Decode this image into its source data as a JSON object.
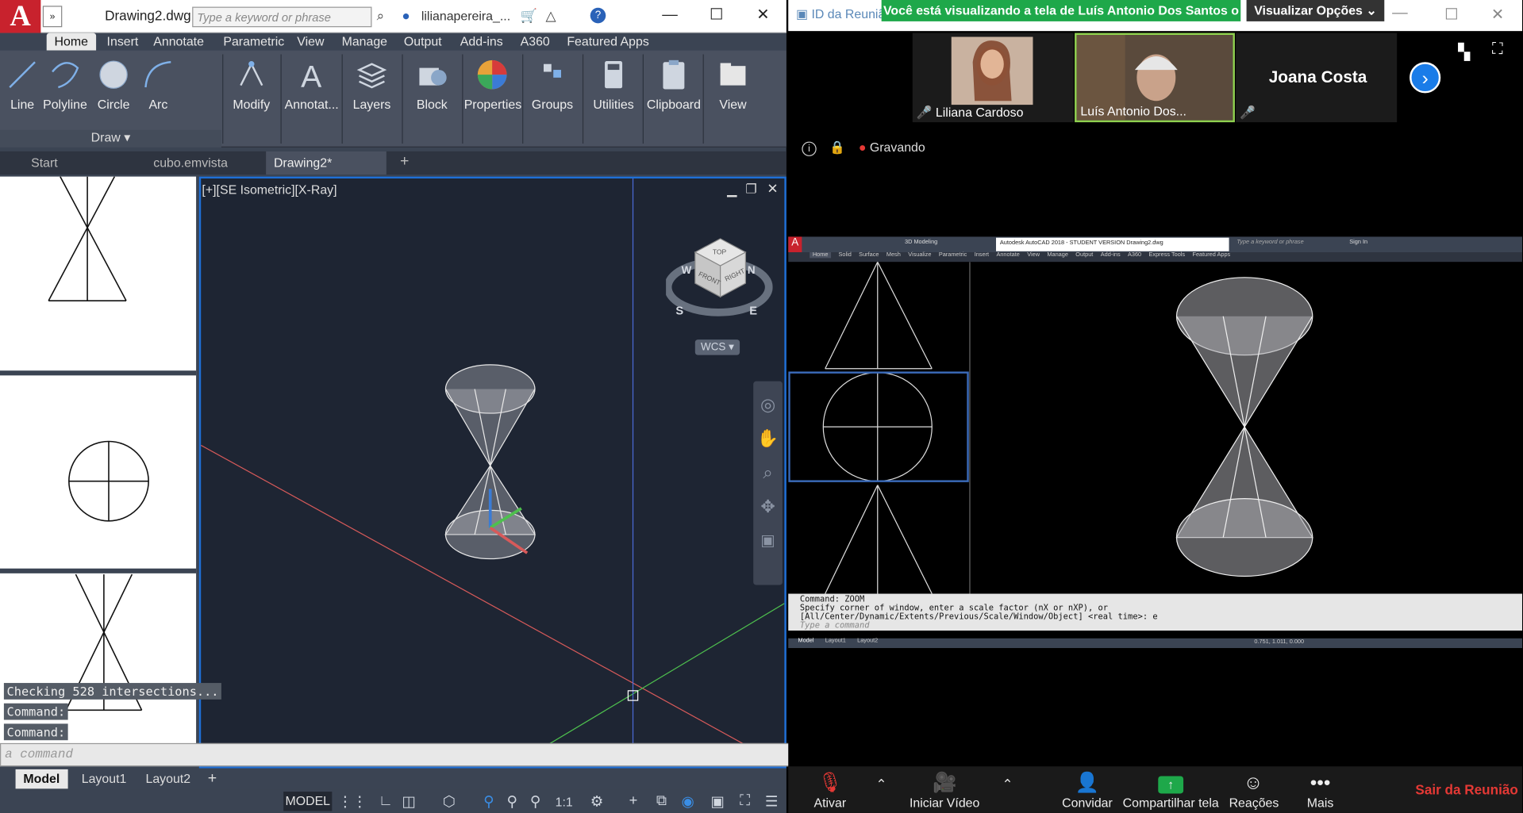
{
  "acad": {
    "title": "Drawing2.dwg",
    "search_placeholder": "Type a keyword or phrase",
    "user": "lilianapereira_...",
    "ribbon_tabs": [
      "Home",
      "Insert",
      "Annotate",
      "Parametric",
      "View",
      "Manage",
      "Output",
      "Add-ins",
      "A360",
      "Featured Apps"
    ],
    "draw_tools": [
      "Line",
      "Polyline",
      "Circle",
      "Arc"
    ],
    "draw_panel": "Draw",
    "panels": [
      "Modify",
      "Annotat...",
      "Layers",
      "Block",
      "Properties",
      "Groups",
      "Utilities",
      "Clipboard",
      "View"
    ],
    "file_tabs": [
      "Start",
      "cubo.emvista",
      "Drawing2*"
    ],
    "viewport_label": "[+][SE Isometric][X-Ray]",
    "viewcube_faces": {
      "top": "TOP",
      "front": "FRONT",
      "right": "RIGHT",
      "compass_s": "S",
      "compass_e": "E",
      "compass_w": "W",
      "compass_n": "N"
    },
    "wcs": "WCS",
    "command_history": [
      "Checking 528 intersections...",
      "Command:",
      "Command:"
    ],
    "command_placeholder": "a command",
    "layout_tabs": [
      "Model",
      "Layout1",
      "Layout2"
    ],
    "status_model": "MODEL",
    "scale": "1:1",
    "colors": {
      "accent": "#1e6fd6",
      "background": "#1e2533",
      "logo": "#c8222d"
    }
  },
  "zoom": {
    "title": "ID da Reuniã",
    "banner": "Você está visualizando a tela de Luís Antonio Dos Santos o",
    "options": "Visualizar Opções",
    "participants": [
      {
        "name": "Liliana Cardoso",
        "muted": true
      },
      {
        "name": "Luís Antonio Dos...",
        "muted": false,
        "active": true
      },
      {
        "name": "Joana Costa",
        "muted": true,
        "video": false
      }
    ],
    "recording": "Gravando",
    "shared_screen": {
      "workspace": "3D Modeling",
      "title": "Autodesk AutoCAD 2018 - STUDENT VERSION    Drawing2.dwg",
      "search": "Type a keyword or phrase",
      "sign_in": "Sign In",
      "tabs": [
        "Home",
        "Solid",
        "Surface",
        "Mesh",
        "Visualize",
        "Parametric",
        "Insert",
        "Annotate",
        "View",
        "Manage",
        "Output",
        "Add-ins",
        "A360",
        "Express Tools",
        "Featured Apps"
      ],
      "command_lines": [
        "Command:  ZOOM",
        "Specify corner of window, enter a scale factor (nX or nXP), or",
        "[All/Center/Dynamic/Extents/Previous/Scale/Window/Object] <real time>: e"
      ],
      "command_placeholder": "Type a command",
      "layout_tabs": [
        "Model",
        "Layout1",
        "Layout2"
      ],
      "coords": "0.751, 1.011, 0.000"
    },
    "controls": [
      {
        "label": "Ativar",
        "icon": "mic-off-icon"
      },
      {
        "label": "Iniciar Vídeo",
        "icon": "video-off-icon"
      },
      {
        "label": "Convidar",
        "icon": "add-user-icon"
      },
      {
        "label": "Compartilhar tela",
        "icon": "share-screen-icon"
      },
      {
        "label": "Reações",
        "icon": "reaction-icon"
      },
      {
        "label": "Mais",
        "icon": "more-icon"
      }
    ],
    "leave": "Sair da Reunião",
    "colors": {
      "share": "#1ea84a",
      "leave": "#e53935",
      "banner": "#1ea84a"
    }
  }
}
